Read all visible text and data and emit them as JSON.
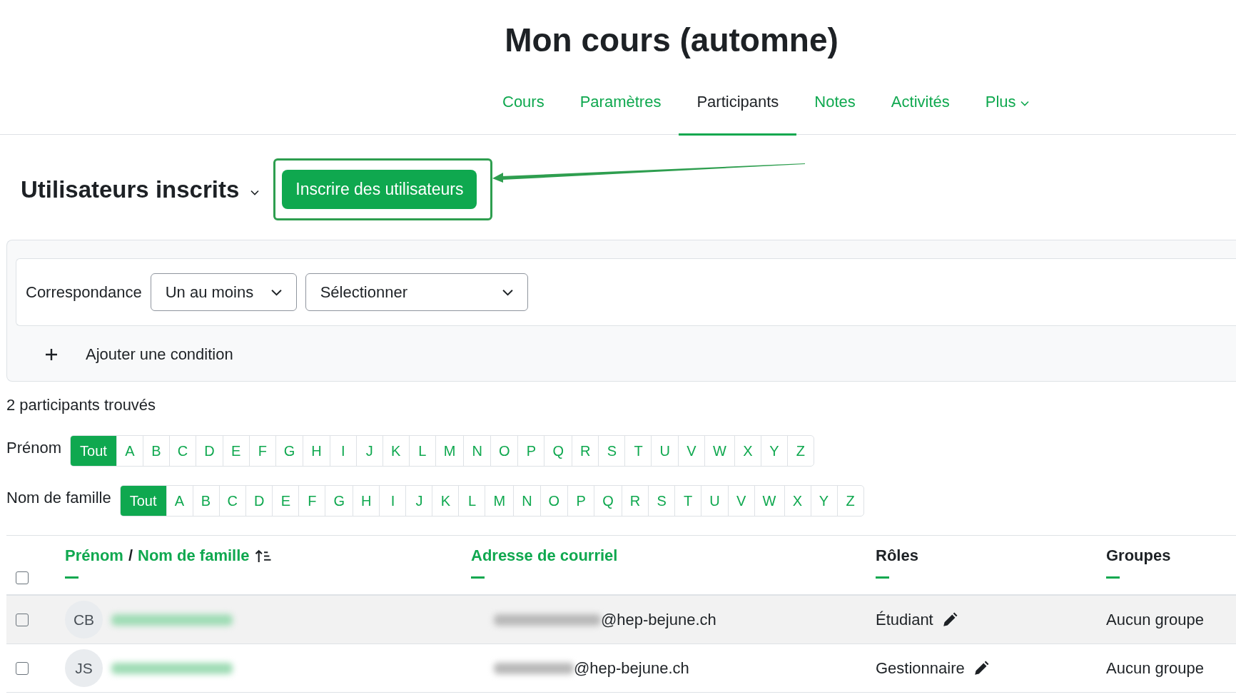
{
  "title": "Mon cours (automne)",
  "tabs": [
    {
      "label": "Cours",
      "selected": false,
      "dropdown": false
    },
    {
      "label": "Paramètres",
      "selected": false,
      "dropdown": false
    },
    {
      "label": "Participants",
      "selected": true,
      "dropdown": false
    },
    {
      "label": "Notes",
      "selected": false,
      "dropdown": false
    },
    {
      "label": "Activités",
      "selected": false,
      "dropdown": false
    },
    {
      "label": "Plus",
      "selected": false,
      "dropdown": true
    }
  ],
  "heading": "Utilisateurs inscrits",
  "enrol_button": "Inscrire des utilisateurs",
  "filter": {
    "match_label": "Correspondance",
    "match_value": "Un au moins",
    "select_value": "Sélectionner",
    "add_condition": "Ajouter une condition"
  },
  "count": "2 participants trouvés",
  "initials_bars": [
    {
      "label": "Prénom",
      "letters": [
        {
          "label": "Tout",
          "selected": true
        },
        {
          "label": "A",
          "selected": false
        },
        {
          "label": "B",
          "selected": false
        },
        {
          "label": "C",
          "selected": false
        },
        {
          "label": "D",
          "selected": false
        },
        {
          "label": "E",
          "selected": false
        },
        {
          "label": "F",
          "selected": false
        },
        {
          "label": "G",
          "selected": false
        },
        {
          "label": "H",
          "selected": false
        },
        {
          "label": "I",
          "selected": false
        },
        {
          "label": "J",
          "selected": false
        },
        {
          "label": "K",
          "selected": false
        },
        {
          "label": "L",
          "selected": false
        },
        {
          "label": "M",
          "selected": false
        },
        {
          "label": "N",
          "selected": false
        },
        {
          "label": "O",
          "selected": false
        },
        {
          "label": "P",
          "selected": false
        },
        {
          "label": "Q",
          "selected": false
        },
        {
          "label": "R",
          "selected": false
        },
        {
          "label": "S",
          "selected": false
        },
        {
          "label": "T",
          "selected": false
        },
        {
          "label": "U",
          "selected": false
        },
        {
          "label": "V",
          "selected": false
        },
        {
          "label": "W",
          "selected": false
        },
        {
          "label": "X",
          "selected": false
        },
        {
          "label": "Y",
          "selected": false
        },
        {
          "label": "Z",
          "selected": false
        }
      ]
    },
    {
      "label": "Nom de famille",
      "letters": [
        {
          "label": "Tout",
          "selected": true
        },
        {
          "label": "A",
          "selected": false
        },
        {
          "label": "B",
          "selected": false
        },
        {
          "label": "C",
          "selected": false
        },
        {
          "label": "D",
          "selected": false
        },
        {
          "label": "E",
          "selected": false
        },
        {
          "label": "F",
          "selected": false
        },
        {
          "label": "G",
          "selected": false
        },
        {
          "label": "H",
          "selected": false
        },
        {
          "label": "I",
          "selected": false
        },
        {
          "label": "J",
          "selected": false
        },
        {
          "label": "K",
          "selected": false
        },
        {
          "label": "L",
          "selected": false
        },
        {
          "label": "M",
          "selected": false
        },
        {
          "label": "N",
          "selected": false
        },
        {
          "label": "O",
          "selected": false
        },
        {
          "label": "P",
          "selected": false
        },
        {
          "label": "Q",
          "selected": false
        },
        {
          "label": "R",
          "selected": false
        },
        {
          "label": "S",
          "selected": false
        },
        {
          "label": "T",
          "selected": false
        },
        {
          "label": "U",
          "selected": false
        },
        {
          "label": "V",
          "selected": false
        },
        {
          "label": "W",
          "selected": false
        },
        {
          "label": "X",
          "selected": false
        },
        {
          "label": "Y",
          "selected": false
        },
        {
          "label": "Z",
          "selected": false
        }
      ]
    }
  ],
  "table": {
    "select_all_checked": false,
    "name_column": {
      "first": "Prénom",
      "separator": "/",
      "last": "Nom de famille",
      "sorted": true
    },
    "columns": [
      {
        "label": "Adresse de courriel",
        "link": true
      },
      {
        "label": "Rôles",
        "link": false
      },
      {
        "label": "Groupes",
        "link": false
      }
    ],
    "rows": [
      {
        "checked": false,
        "highlighted": true,
        "initials": "CB",
        "email": "@hep-bejune.ch",
        "role": "Étudiant",
        "groups": "Aucun groupe"
      },
      {
        "checked": false,
        "highlighted": false,
        "initials": "JS",
        "email": "@hep-bejune.ch",
        "role": "Gestionnaire",
        "groups": "Aucun groupe"
      }
    ]
  }
}
